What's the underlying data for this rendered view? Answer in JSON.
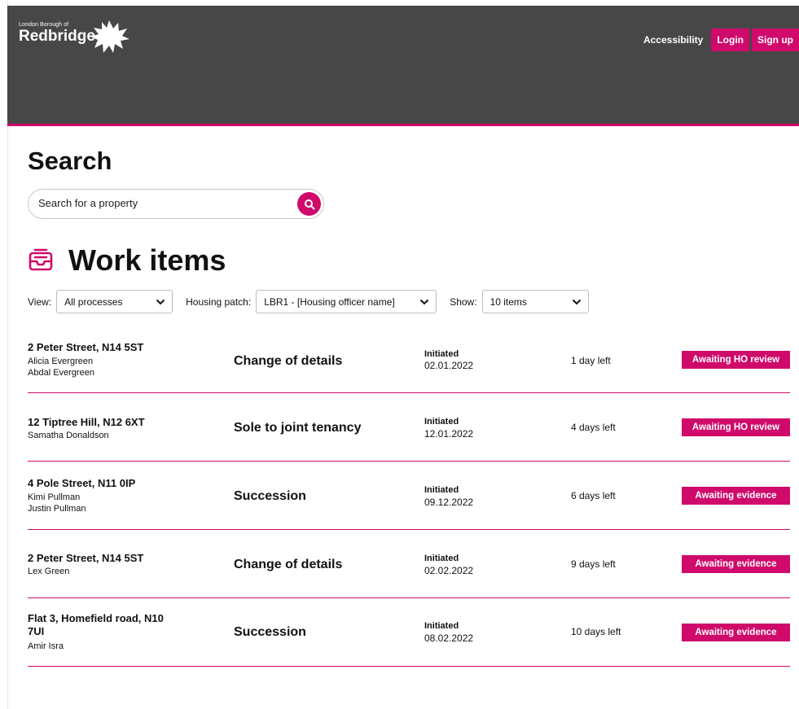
{
  "header": {
    "logo_small": "London Borough of",
    "logo_big": "Redbridge",
    "accessibility_label": "Accessibility",
    "login_label": "Login",
    "signup_label": "Sign up"
  },
  "search": {
    "title": "Search",
    "placeholder": "Search for a property"
  },
  "work_items": {
    "title": "Work items",
    "filters": {
      "view_label": "View:",
      "view_value": "All processes",
      "patch_label": "Housing patch:",
      "patch_value": "LBR1 - [Housing officer name]",
      "show_label": "Show:",
      "show_value": "10 items"
    },
    "rows": [
      {
        "address": "2 Peter Street, N14 5ST",
        "people": [
          "Alicia Evergreen",
          "Abdal Evergreen"
        ],
        "process": "Change of details",
        "initiated_label": "Initiated",
        "date": "02.01.2022",
        "days_left": "1 day left",
        "status": "Awaiting HO review"
      },
      {
        "address": "12 Tiptree Hill, N12 6XT",
        "people": [
          "Samatha Donaldson"
        ],
        "process": "Sole to joint tenancy",
        "initiated_label": "Initiated",
        "date": "12.01.2022",
        "days_left": "4 days left",
        "status": "Awaiting HO review"
      },
      {
        "address": "4 Pole Street, N11 0IP",
        "people": [
          "Kimi Pullman",
          "Justin Pullman"
        ],
        "process": "Succession",
        "initiated_label": "Initiated",
        "date": "09.12.2022",
        "days_left": "6 days left",
        "status": "Awaiting evidence"
      },
      {
        "address": "2 Peter Street, N14 5ST",
        "people": [
          "Lex Green"
        ],
        "process": "Change of details",
        "initiated_label": "Initiated",
        "date": "02.02.2022",
        "days_left": "9 days left",
        "status": "Awaiting evidence"
      },
      {
        "address": "Flat 3, Homefield road, N10 7UI",
        "people": [
          "Amir Isra"
        ],
        "process": "Succession",
        "initiated_label": "Initiated",
        "date": "08.02.2022",
        "days_left": "10 days left",
        "status": "Awaiting evidence"
      }
    ]
  },
  "colors": {
    "header_bg": "#474747",
    "accent": "#cf0a6b"
  },
  "icons": {
    "logo": "leaf-icon",
    "search": "search-icon",
    "work_items": "inbox-icon",
    "select": "chevron-down-icon"
  }
}
